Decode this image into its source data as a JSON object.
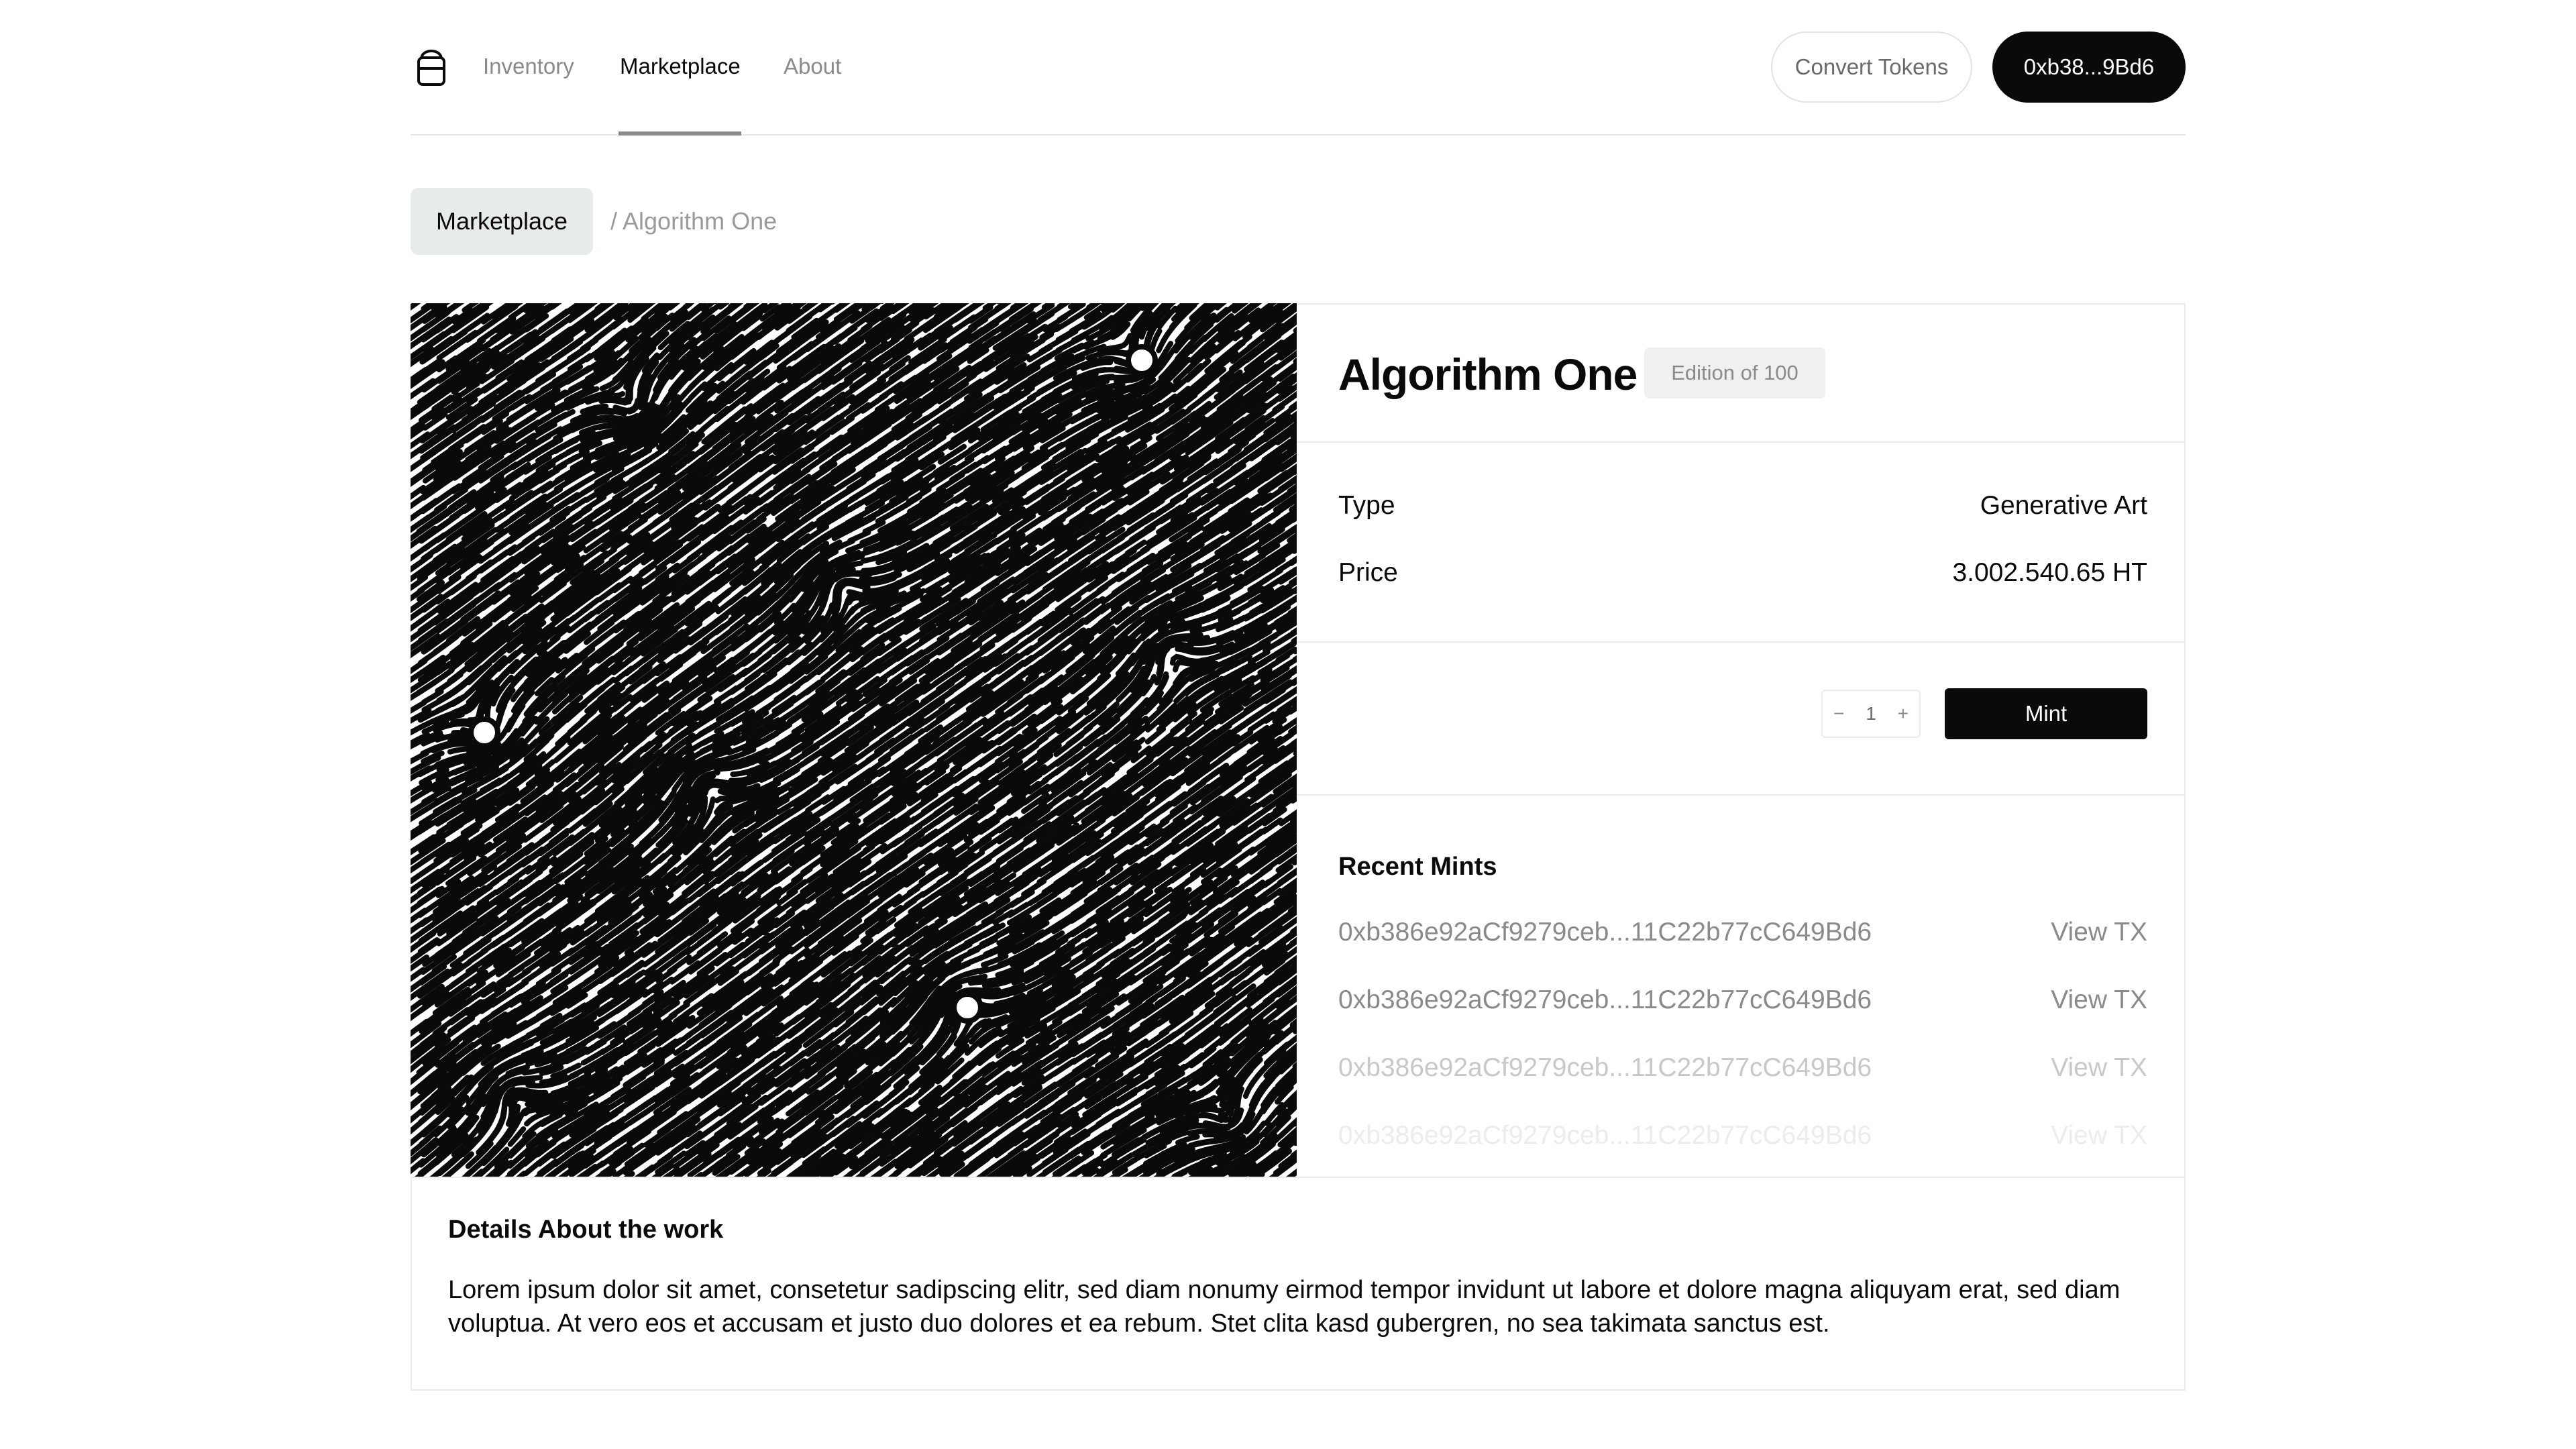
{
  "nav": {
    "links": [
      "Inventory",
      "Marketplace",
      "About"
    ],
    "active": "Marketplace",
    "convert_label": "Convert Tokens",
    "wallet_label": "0xb38...9Bd6"
  },
  "breadcrumb": {
    "root": "Marketplace",
    "current": "/ Algorithm One"
  },
  "artwork": {
    "description_icon": "generative-maze-artwork"
  },
  "item": {
    "title": "Algorithm One",
    "edition": "Edition of 100",
    "type_label": "Type",
    "type_value": "Generative Art",
    "price_label": "Price",
    "price_value": "3.002.540.65 HT"
  },
  "mint": {
    "decrement": "−",
    "quantity": "1",
    "increment": "+",
    "button_label": "Mint"
  },
  "recent_mints": {
    "title": "Recent Mints",
    "rows": [
      {
        "hash": "0xb386e92aCf9279ceb...11C22b77cC649Bd6",
        "link": "View TX"
      },
      {
        "hash": "0xb386e92aCf9279ceb...11C22b77cC649Bd6",
        "link": "View TX"
      },
      {
        "hash": "0xb386e92aCf9279ceb...11C22b77cC649Bd6",
        "link": "View TX"
      },
      {
        "hash": "0xb386e92aCf9279ceb...11C22b77cC649Bd6",
        "link": "View TX"
      }
    ]
  },
  "details": {
    "title": "Details About the work",
    "body": "Lorem ipsum dolor sit amet, consetetur sadipscing elitr, sed diam nonumy eirmod tempor invidunt ut labore et dolore magna aliquyam erat, sed diam voluptua. At vero eos et accusam et justo duo dolores et ea rebum. Stet clita kasd gubergren, no sea takimata sanctus est."
  }
}
